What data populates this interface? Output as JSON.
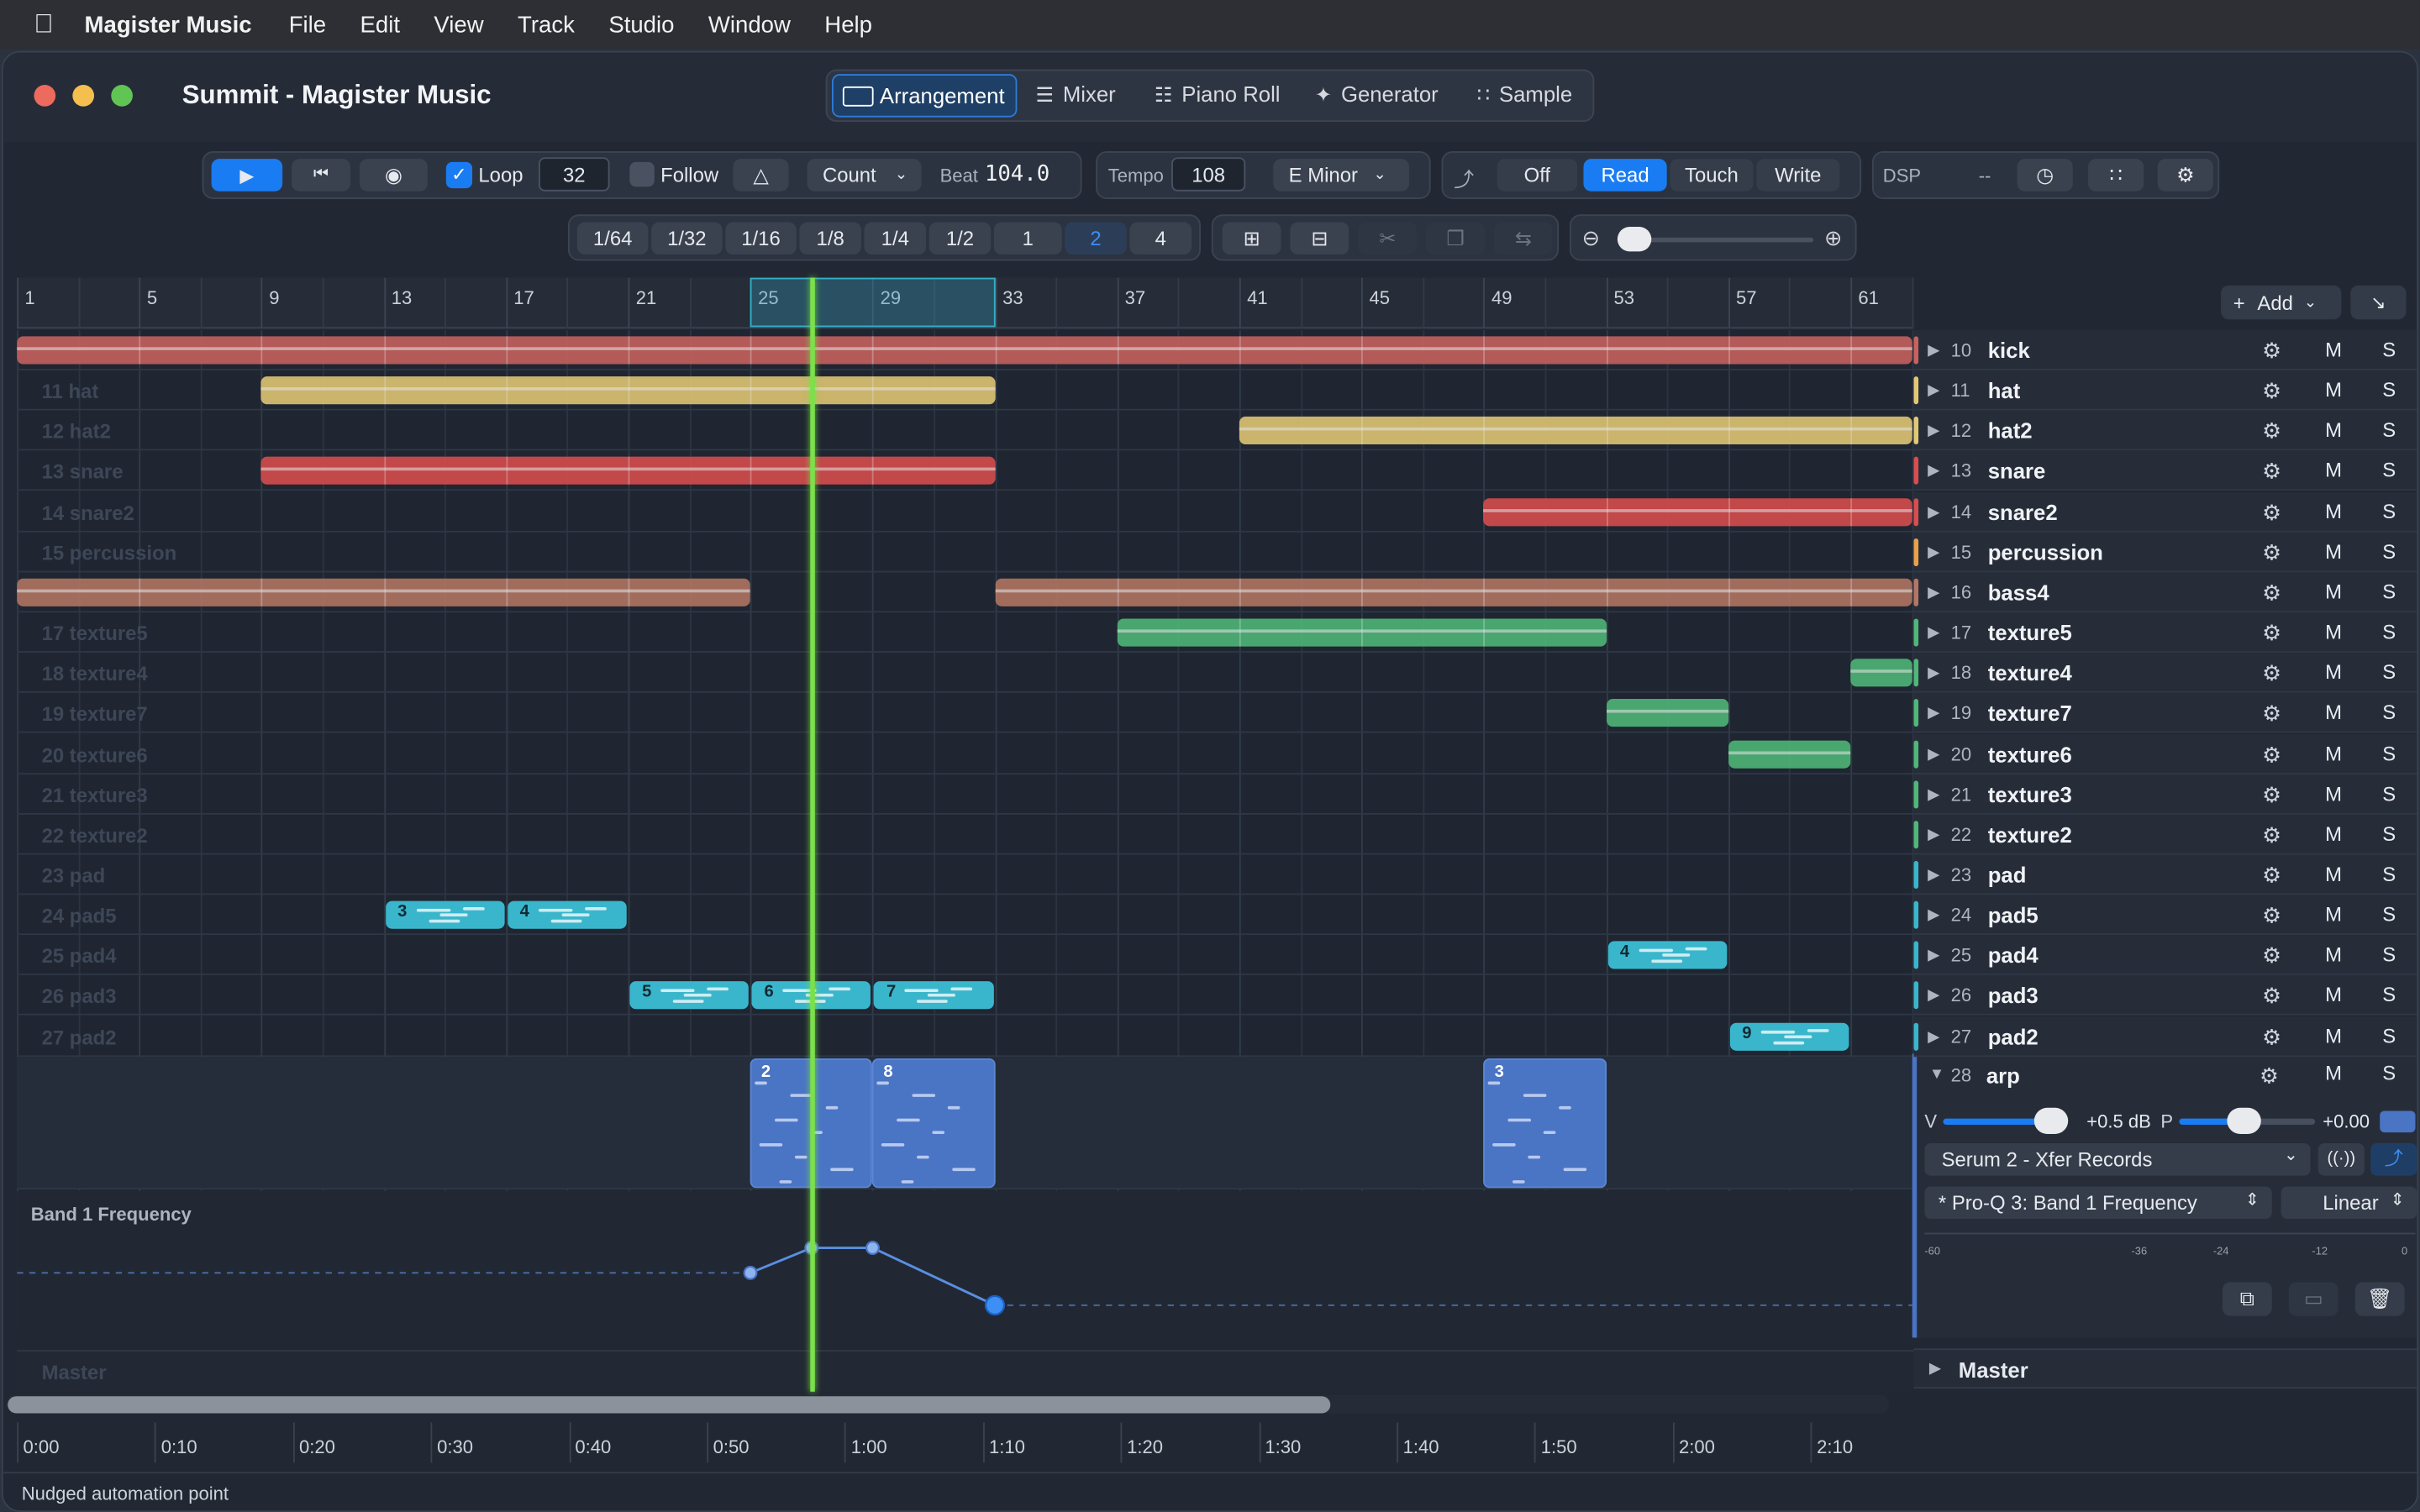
{
  "menubar": {
    "app": "Magister Music",
    "items": [
      "File",
      "Edit",
      "View",
      "Track",
      "Studio",
      "Window",
      "Help"
    ]
  },
  "window": {
    "title": "Summit - Magister Music",
    "views": [
      "Arrangement",
      "Mixer",
      "Piano Roll",
      "Generator",
      "Sample"
    ],
    "active_view": "Arrangement"
  },
  "transport": {
    "loop_label": "Loop",
    "loop_checked": true,
    "loop_length": "32",
    "follow_label": "Follow",
    "count_label": "Count",
    "beat_label": "Beat",
    "beat_value": "104.0",
    "tempo_label": "Tempo",
    "tempo_value": "108",
    "key": "E Minor",
    "automation_modes": [
      "Off",
      "Read",
      "Touch",
      "Write"
    ],
    "automation_mode_active": "Read",
    "dsp_label": "DSP",
    "dsp_value": "--"
  },
  "grid": {
    "divisions": [
      "1/64",
      "1/32",
      "1/16",
      "1/8",
      "1/4",
      "1/2",
      "1",
      "2",
      "4"
    ],
    "active": "2",
    "zoom_level": 0.05
  },
  "ruler": {
    "labels": [
      "1",
      "5",
      "9",
      "13",
      "17",
      "21",
      "25",
      "29",
      "33",
      "37",
      "41",
      "45",
      "49",
      "53",
      "57",
      "61"
    ],
    "loop_start": "25",
    "loop_end": "33"
  },
  "add_button": "Add",
  "tracks": [
    {
      "index": "10",
      "name": "kick",
      "lane_label": "",
      "color": "#c9625e"
    },
    {
      "index": "11",
      "name": "hat",
      "lane_label": "11 hat",
      "color": "#e3c874"
    },
    {
      "index": "12",
      "name": "hat2",
      "lane_label": "12 hat2",
      "color": "#e3c874"
    },
    {
      "index": "13",
      "name": "snare",
      "lane_label": "13 snare",
      "color": "#d94d4d"
    },
    {
      "index": "14",
      "name": "snare2",
      "lane_label": "14 snare2",
      "color": "#d94d4d"
    },
    {
      "index": "15",
      "name": "percussion",
      "lane_label": "15 percussion",
      "color": "#e8a04a"
    },
    {
      "index": "16",
      "name": "bass4",
      "lane_label": "",
      "color": "#b57664"
    },
    {
      "index": "17",
      "name": "texture5",
      "lane_label": "17 texture5",
      "color": "#4fb878"
    },
    {
      "index": "18",
      "name": "texture4",
      "lane_label": "18 texture4",
      "color": "#4fb878"
    },
    {
      "index": "19",
      "name": "texture7",
      "lane_label": "19 texture7",
      "color": "#4fb878"
    },
    {
      "index": "20",
      "name": "texture6",
      "lane_label": "20 texture6",
      "color": "#4fb878"
    },
    {
      "index": "21",
      "name": "texture3",
      "lane_label": "21 texture3",
      "color": "#4fb878"
    },
    {
      "index": "22",
      "name": "texture2",
      "lane_label": "22 texture2",
      "color": "#4fb878"
    },
    {
      "index": "23",
      "name": "pad",
      "lane_label": "23 pad",
      "color": "#3ab6cc"
    },
    {
      "index": "24",
      "name": "pad5",
      "lane_label": "24 pad5",
      "color": "#3ab6cc"
    },
    {
      "index": "25",
      "name": "pad4",
      "lane_label": "25 pad4",
      "color": "#3ab6cc"
    },
    {
      "index": "26",
      "name": "pad3",
      "lane_label": "26 pad3",
      "color": "#3ab6cc"
    },
    {
      "index": "27",
      "name": "pad2",
      "lane_label": "27 pad2",
      "color": "#3ab6cc"
    }
  ],
  "clips": [
    {
      "track": 0,
      "start": 1,
      "end": 63,
      "color": "#c9625e"
    },
    {
      "track": 1,
      "start": 9,
      "end": 33,
      "color": "#e3c874"
    },
    {
      "track": 2,
      "start": 41,
      "end": 63,
      "color": "#e3c874"
    },
    {
      "track": 3,
      "start": 9,
      "end": 33,
      "color": "#d94d4d"
    },
    {
      "track": 4,
      "start": 49,
      "end": 63,
      "color": "#d94d4d"
    },
    {
      "track": 6,
      "start": 1,
      "end": 25,
      "color": "#b57664"
    },
    {
      "track": 6,
      "start": 33,
      "end": 63,
      "color": "#b57664"
    },
    {
      "track": 7,
      "start": 37,
      "end": 53,
      "color": "#4fb878"
    },
    {
      "track": 8,
      "start": 61,
      "end": 63,
      "color": "#4fb878"
    },
    {
      "track": 9,
      "start": 53,
      "end": 57,
      "color": "#4fb878"
    },
    {
      "track": 10,
      "start": 57,
      "end": 61,
      "color": "#4fb878"
    }
  ],
  "pattern_clips": [
    {
      "track": 14,
      "start": 13,
      "end": 17,
      "label": "3"
    },
    {
      "track": 14,
      "start": 17,
      "end": 21,
      "label": "4"
    },
    {
      "track": 15,
      "start": 53,
      "end": 57,
      "label": "4"
    },
    {
      "track": 16,
      "start": 21,
      "end": 25,
      "label": "5"
    },
    {
      "track": 16,
      "start": 25,
      "end": 29,
      "label": "6"
    },
    {
      "track": 16,
      "start": 29,
      "end": 33,
      "label": "7"
    },
    {
      "track": 17,
      "start": 57,
      "end": 61,
      "label": "9"
    }
  ],
  "arp": {
    "index": "28",
    "name": "arp",
    "clips": [
      {
        "start": 25,
        "end": 29,
        "label": "2"
      },
      {
        "start": 29,
        "end": 33,
        "label": "8"
      },
      {
        "start": 49,
        "end": 53,
        "label": "3"
      }
    ],
    "volume_label": "V",
    "volume_value": "+0.5 dB",
    "pan_label": "P",
    "pan_value": "+0.00",
    "instrument": "Serum 2 - Xfer Records",
    "automation_param": "* Pro-Q 3: Band 1 Frequency",
    "curve": "Linear",
    "meter_ticks": [
      "-60",
      "-36",
      "-24",
      "-12",
      "0"
    ]
  },
  "automation": {
    "label": "Band 1 Frequency",
    "points": [
      {
        "bar": 25,
        "value": 0.45
      },
      {
        "bar": 27,
        "value": 0.72
      },
      {
        "bar": 29,
        "value": 0.72
      },
      {
        "bar": 33,
        "value": 0.1
      }
    ]
  },
  "master_label": "Master",
  "playhead_bar": 27,
  "time_ruler": [
    "0:00",
    "0:10",
    "0:20",
    "0:30",
    "0:40",
    "0:50",
    "1:00",
    "1:10",
    "1:20",
    "1:30",
    "1:40",
    "1:50",
    "2:00",
    "2:10"
  ],
  "status": "Nudged automation point",
  "colors": {
    "accent": "#1a7cf2",
    "playhead": "#7be14a",
    "arp_clip": "#4a74c4"
  }
}
